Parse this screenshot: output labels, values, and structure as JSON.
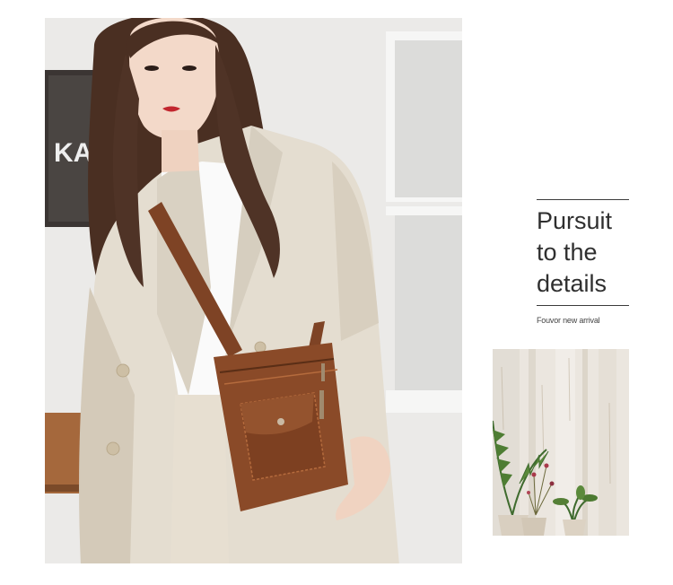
{
  "headline": {
    "line1": "Pursuit",
    "line2": "to the",
    "line3": "details"
  },
  "subheadline": "Fouvor new arrival",
  "photo": {
    "background_sign_text": "KA",
    "subject": "woman in beige blazer with brown crossbody bag"
  },
  "thumbnail": {
    "subject": "potted plants against whitewashed wood wall"
  },
  "colors": {
    "bag_leather": "#8a4a28",
    "blazer": "#e4ddd0",
    "rule": "#3b3b3b",
    "text": "#2f2f2f"
  }
}
